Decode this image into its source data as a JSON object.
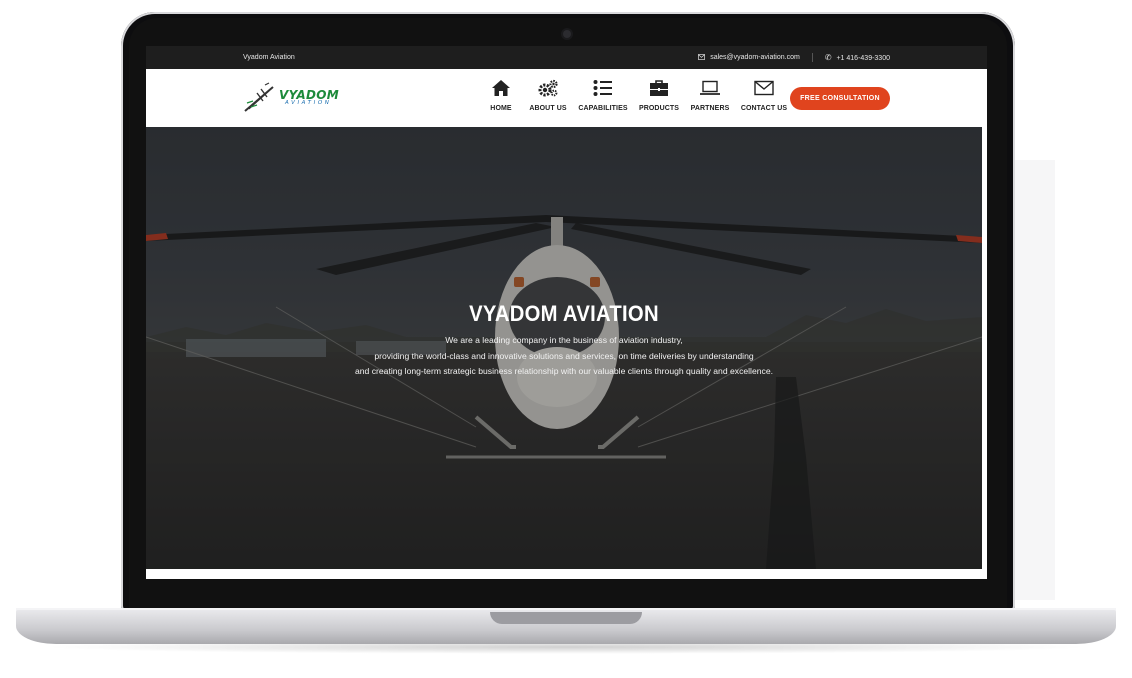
{
  "topbar": {
    "company": "Vyadom Aviation",
    "email": "sales@vyadom-aviation.com",
    "phone": "+1 416-439-3300",
    "email_icon": "envelope-icon",
    "phone_icon": "phone-icon"
  },
  "logo": {
    "main": "VYADOM",
    "sub": "AVIATION",
    "colors": {
      "main": "#1d8a3a",
      "sub": "#1c6fb0"
    }
  },
  "nav": {
    "items": [
      {
        "label": "HOME",
        "icon": "home-icon"
      },
      {
        "label": "ABOUT US",
        "icon": "gears-icon"
      },
      {
        "label": "CAPABILITIES",
        "icon": "list-icon"
      },
      {
        "label": "PRODUCTS",
        "icon": "briefcase-icon"
      },
      {
        "label": "PARTNERS",
        "icon": "laptop-icon"
      },
      {
        "label": "CONTACT US",
        "icon": "envelope-icon"
      }
    ],
    "cta_label": "FREE CONSULTATION",
    "cta_color": "#e0441e"
  },
  "hero": {
    "title": "VYADOM AVIATION",
    "lines": [
      "We are a leading company in the business of aviation industry,",
      "providing the world-class and innovative solutions and services, on time deliveries by understanding",
      "and creating long-term strategic business relationship with our valuable clients through quality and excellence."
    ]
  }
}
